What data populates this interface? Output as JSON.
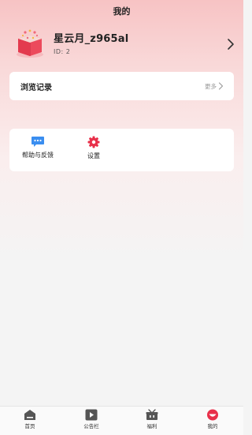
{
  "header": {
    "title": "我的"
  },
  "profile": {
    "username": "星云月_z965al",
    "id_text": "ID: 2"
  },
  "history": {
    "title": "浏览记录",
    "more_label": "更多"
  },
  "tools": [
    {
      "label": "帮助与反馈",
      "icon": "message-dots-icon"
    },
    {
      "label": "设置",
      "icon": "gear-icon"
    }
  ],
  "tabbar": [
    {
      "label": "首页",
      "icon": "home-icon"
    },
    {
      "label": "公告栏",
      "icon": "play-icon"
    },
    {
      "label": "福利",
      "icon": "gift-icon"
    },
    {
      "label": "我的",
      "icon": "profile-face-icon",
      "active": true
    }
  ],
  "colors": {
    "accent": "#e8304a",
    "tool_help": "#3a8ef0",
    "tool_settings": "#e8304a",
    "tab_icon": "#555555"
  }
}
